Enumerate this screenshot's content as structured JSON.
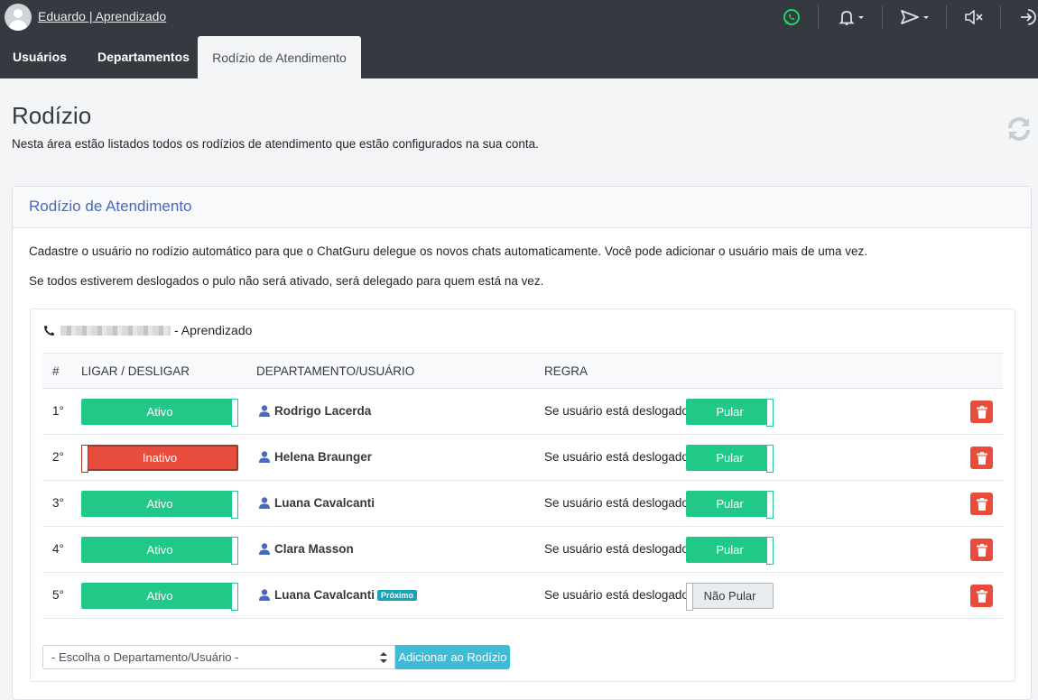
{
  "topbar": {
    "user_link": "Eduardo | Aprendizado",
    "icons": [
      "whatsapp-icon",
      "bell-icon",
      "send-icon",
      "mute-icon",
      "logout-icon"
    ],
    "whatsapp_color": "#25d366"
  },
  "nav": {
    "tabs": [
      {
        "label": "Usuários",
        "active": false
      },
      {
        "label": "Departamentos",
        "active": false
      },
      {
        "label": "Rodízio de Atendimento",
        "active": true
      }
    ]
  },
  "header": {
    "title": "Rodízio",
    "subtitle": "Nesta área estão listados todos os rodízios de atendimento que estão configurados na sua conta."
  },
  "card": {
    "title": "Rodízio de Atendimento",
    "paragraph1": "Cadastre o usuário no rodízio automático para que o ChatGuru delegue os novos chats automaticamente. Você pode adicionar o usuário mais de uma vez.",
    "paragraph2": "Se todos estiverem deslogados o pulo não será ativado, será delegado para quem está na vez.",
    "phone_suffix": "- Aprendizado",
    "table": {
      "headers": {
        "num": "#",
        "toggle": "LIGAR / DESLIGAR",
        "dept": "DEPARTAMENTO/USUÁRIO",
        "rule": "REGRA"
      },
      "rows": [
        {
          "num": "1°",
          "status": "Ativo",
          "active": true,
          "user": "Rodrigo Lacerda",
          "badge": "",
          "rule_label": "Se usuário está deslogado:",
          "rule": "Pular",
          "skip": true
        },
        {
          "num": "2°",
          "status": "Inativo",
          "active": false,
          "user": "Helena Braunger",
          "badge": "",
          "rule_label": "Se usuário está deslogado:",
          "rule": "Pular",
          "skip": true
        },
        {
          "num": "3°",
          "status": "Ativo",
          "active": true,
          "user": "Luana Cavalcanti",
          "badge": "",
          "rule_label": "Se usuário está deslogado:",
          "rule": "Pular",
          "skip": true
        },
        {
          "num": "4°",
          "status": "Ativo",
          "active": true,
          "user": "Clara Masson",
          "badge": "",
          "rule_label": "Se usuário está deslogado:",
          "rule": "Pular",
          "skip": true
        },
        {
          "num": "5°",
          "status": "Ativo",
          "active": true,
          "user": "Luana Cavalcanti",
          "badge": "Próximo",
          "rule_label": "Se usuário está deslogado:",
          "rule": "Não Pular",
          "skip": false
        }
      ]
    },
    "select_placeholder": "- Escolha o Departamento/Usuário -",
    "add_button": "Adicionar ao Rodízio"
  },
  "colors": {
    "active_green": "#20c987",
    "inactive_red": "#e74c3c",
    "accent_blue": "#4a69bd",
    "add_button": "#3dbbd7"
  }
}
